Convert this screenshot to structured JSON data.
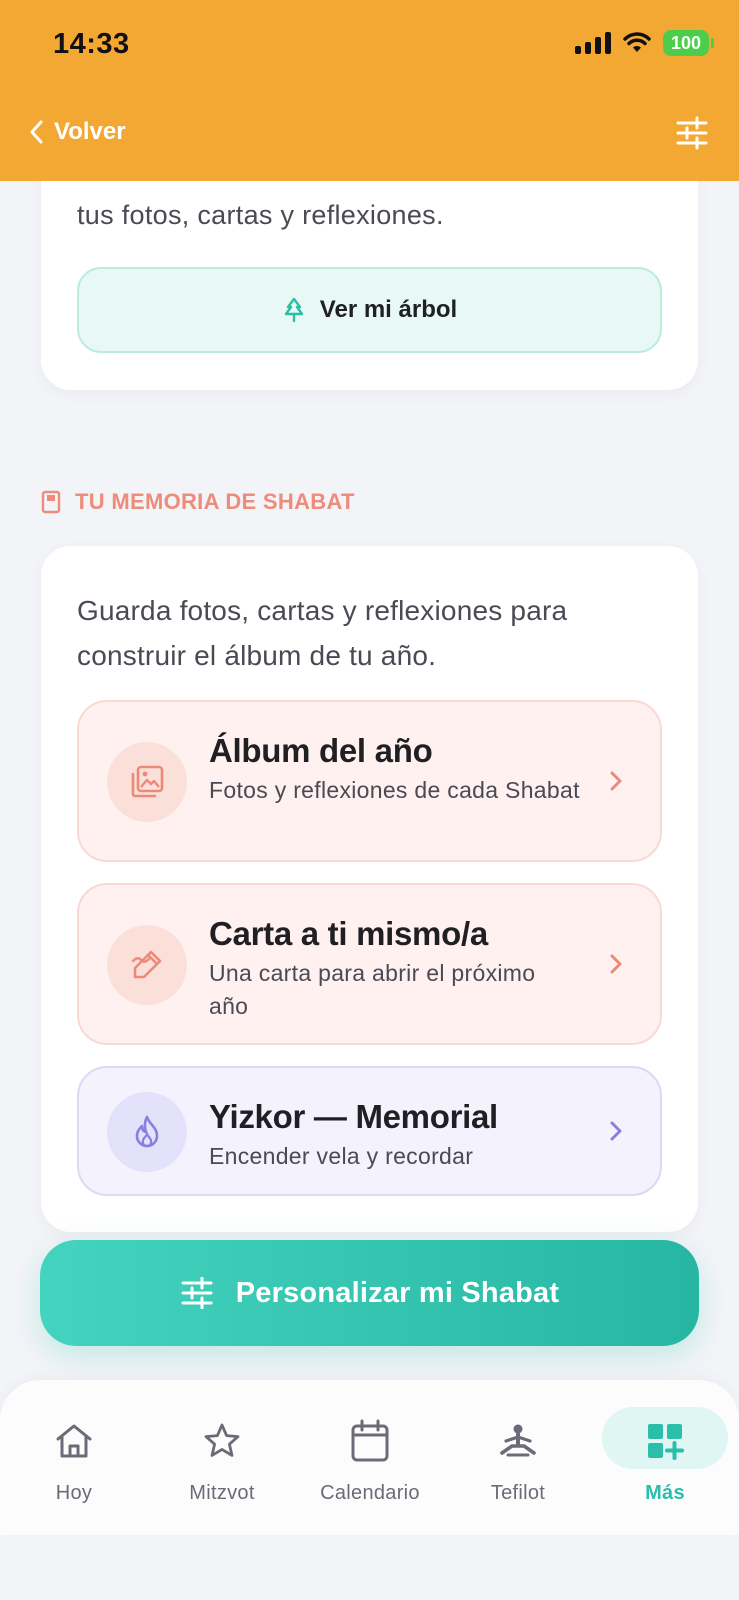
{
  "status_bar": {
    "time": "14:33",
    "battery": "100"
  },
  "header": {
    "back_label": "Volver"
  },
  "tree_card": {
    "text": "tus fotos, cartas y reflexiones.",
    "button_label": "Ver mi árbol"
  },
  "memory_section": {
    "label": "TU MEMORIA DE SHABAT",
    "intro": "Guarda fotos, cartas y reflexiones para construir el álbum de tu año.",
    "items": [
      {
        "title": "Álbum del año",
        "subtitle": "Fotos y reflexiones de cada Shabat",
        "icon": "photo-album-icon"
      },
      {
        "title": "Carta a ti mismo/a",
        "subtitle": "Una carta para abrir el próximo año",
        "icon": "pen-write-icon"
      },
      {
        "title": "Yizkor — Memorial",
        "subtitle": "Encender vela y recordar",
        "icon": "flame-icon"
      }
    ]
  },
  "cta": {
    "label": "Personalizar mi Shabat"
  },
  "bottom_nav": {
    "items": [
      {
        "label": "Hoy",
        "icon": "home-icon"
      },
      {
        "label": "Mitzvot",
        "icon": "star-icon"
      },
      {
        "label": "Calendario",
        "icon": "calendar-icon"
      },
      {
        "label": "Tefilot",
        "icon": "prayer-icon"
      },
      {
        "label": "Más",
        "icon": "grid-plus-icon",
        "active": true
      }
    ]
  },
  "colors": {
    "header": "#f3a833",
    "accent_teal": "#2bbfa9",
    "section_label": "#ef8b7a",
    "pink_card": "#fef1ef",
    "lavender_card": "#f3f2fd"
  }
}
